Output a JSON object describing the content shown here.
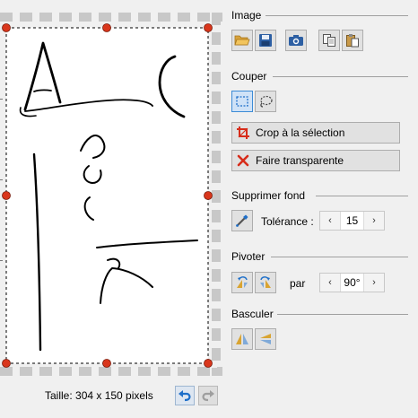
{
  "canvas": {
    "size_label": "Taille: 304 x 150 pixels"
  },
  "history": {
    "undo_icon": "undo-icon",
    "redo_icon": "redo-icon"
  },
  "sections": {
    "image": {
      "title": "Image"
    },
    "crop": {
      "title": "Couper",
      "crop_selection_label": "Crop à la sélection",
      "make_transparent_label": "Faire transparente"
    },
    "remove_bg": {
      "title": "Supprimer fond",
      "tolerance_label": "Tolérance :",
      "tolerance_value": "15"
    },
    "rotate": {
      "title": "Pivoter",
      "by_label": "par",
      "angle_value": "90°"
    },
    "flip": {
      "title": "Basculer"
    }
  },
  "colors": {
    "accent": "#1e6fc9",
    "handle": "#d9361c",
    "red_x": "#d72c1a"
  }
}
